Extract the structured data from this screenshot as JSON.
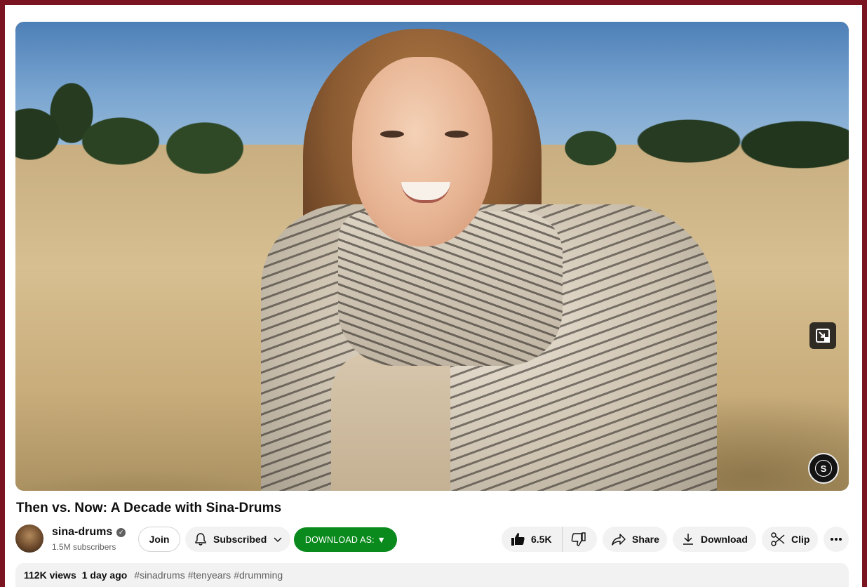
{
  "video": {
    "title": "Then vs. Now: A Decade with Sina-Drums",
    "watermark_letter": "S",
    "icons": {
      "miniplayer": "miniplayer-icon",
      "watermark": "sina-drums-logo"
    }
  },
  "channel": {
    "name": "sina-drums",
    "subscribers": "1.5M subscribers",
    "verified_icon": "verified-check-icon"
  },
  "actions": {
    "join_label": "Join",
    "subscribed_label": "Subscribed",
    "download_as_label": "DOWNLOAD AS: ▼",
    "like_count": "6.5K",
    "share_label": "Share",
    "download_label": "Download",
    "clip_label": "Clip"
  },
  "description": {
    "views": "112K views",
    "date": "1 day ago",
    "hashtags": [
      "#sinadrums",
      "#tenyears",
      "#drumming"
    ]
  },
  "colors": {
    "download_as_button": "#0a8a1c",
    "frame_border": "#7a1420",
    "pill_background": "#f2f2f2"
  }
}
